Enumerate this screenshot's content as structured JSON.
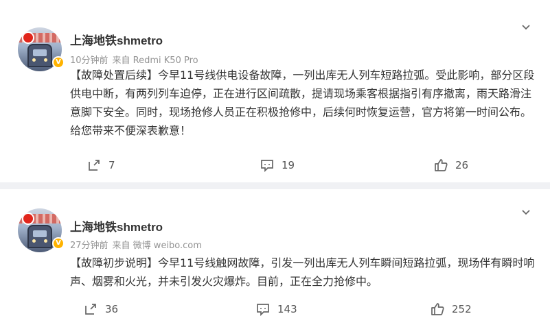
{
  "posts": [
    {
      "username": "上海地铁shmetro",
      "time": "10分钟前",
      "source": "来自 Redmi K50 Pro",
      "verified_badge": "V",
      "text": "【故障处置后续】今早11号线供电设备故障，一列出库无人列车短路拉弧。受此影响，部分区段供电中断，有两列列车迫停，正在进行区间疏散，提请现场乘客根据指引有序撤离，雨天路滑注意脚下安全。同时，现场抢修人员正在积极抢修中，后续何时恢复运营，官方将第一时间公布。给您带来不便深表歉意！",
      "reposts": "7",
      "comments": "19",
      "likes": "26"
    },
    {
      "username": "上海地铁shmetro",
      "time": "27分钟前",
      "source": "来自 微博 weibo.com",
      "verified_badge": "V",
      "text": "【故障初步说明】今早11号线触网故障，引发一列出库无人列车瞬间短路拉弧，现场伴有瞬时响声、烟雾和火光，并未引发火灾爆炸。目前，正在全力抢修中。",
      "reposts": "36",
      "comments": "143",
      "likes": "252"
    }
  ],
  "icons": {
    "repost": "share-icon",
    "comment": "comment-icon",
    "like": "thumbs-up-icon",
    "menu": "chevron-down-icon"
  },
  "colors": {
    "background": "#f0f1f4",
    "card": "#ffffff",
    "verified": "#ffb300",
    "meta": "#939393"
  }
}
